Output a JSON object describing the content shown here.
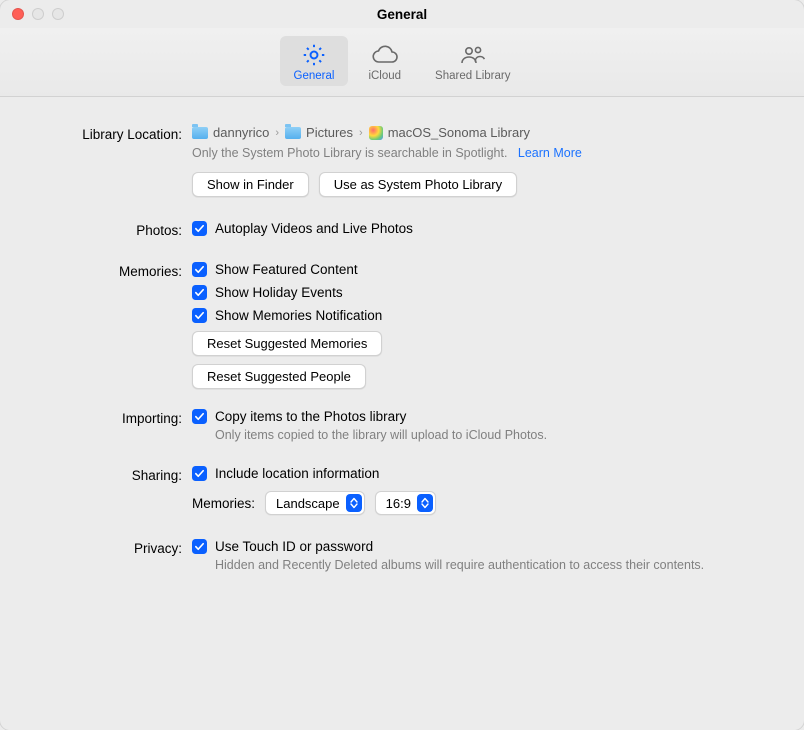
{
  "window": {
    "title": "General"
  },
  "toolbar": {
    "items": [
      {
        "label": "General"
      },
      {
        "label": "iCloud"
      },
      {
        "label": "Shared Library"
      }
    ]
  },
  "library": {
    "label": "Library Location:",
    "segments": [
      "dannyrico",
      "Pictures",
      "macOS_Sonoma Library"
    ],
    "hint": "Only the System Photo Library is searchable in Spotlight.",
    "learn_more": "Learn More",
    "show_in_finder": "Show in Finder",
    "use_as_system": "Use as System Photo Library"
  },
  "photos": {
    "label": "Photos:",
    "autoplay": "Autoplay Videos and Live Photos"
  },
  "memories": {
    "label": "Memories:",
    "featured": "Show Featured Content",
    "holiday": "Show Holiday Events",
    "notification": "Show Memories Notification",
    "reset_memories": "Reset Suggested Memories",
    "reset_people": "Reset Suggested People"
  },
  "importing": {
    "label": "Importing:",
    "copy": "Copy items to the Photos library",
    "hint": "Only items copied to the library will upload to iCloud Photos."
  },
  "sharing": {
    "label": "Sharing:",
    "include_location": "Include location information",
    "memories_label": "Memories:",
    "orientation": "Landscape",
    "aspect": "16:9"
  },
  "privacy": {
    "label": "Privacy:",
    "touchid": "Use Touch ID or password",
    "hint": "Hidden and Recently Deleted albums will require authentication to access their contents."
  }
}
